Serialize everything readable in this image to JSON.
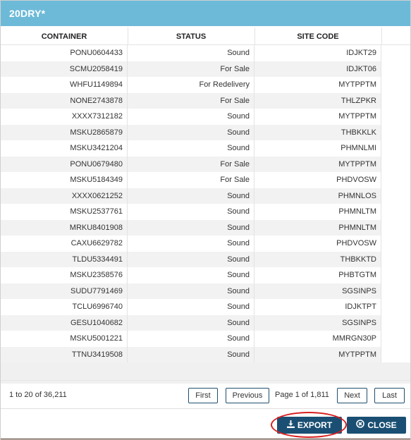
{
  "window": {
    "title": "20DRY*"
  },
  "table": {
    "columns": [
      "CONTAINER",
      "STATUS",
      "SITE CODE"
    ],
    "rows": [
      [
        "PONU0604433",
        "Sound",
        "IDJKT29"
      ],
      [
        "SCMU2058419",
        "For Sale",
        "IDJKT06"
      ],
      [
        "WHFU1149894",
        "For Redelivery",
        "MYTPPTM"
      ],
      [
        "NONE2743878",
        "For Sale",
        "THLZPKR"
      ],
      [
        "XXXX7312182",
        "Sound",
        "MYTPPTM"
      ],
      [
        "MSKU2865879",
        "Sound",
        "THBKKLK"
      ],
      [
        "MSKU3421204",
        "Sound",
        "PHMNLMI"
      ],
      [
        "PONU0679480",
        "For Sale",
        "MYTPPTM"
      ],
      [
        "MSKU5184349",
        "For Sale",
        "PHDVOSW"
      ],
      [
        "XXXX0621252",
        "Sound",
        "PHMNLOS"
      ],
      [
        "MSKU2537761",
        "Sound",
        "PHMNLTM"
      ],
      [
        "MRKU8401908",
        "Sound",
        "PHMNLTM"
      ],
      [
        "CAXU6629782",
        "Sound",
        "PHDVOSW"
      ],
      [
        "TLDU5334491",
        "Sound",
        "THBKKTD"
      ],
      [
        "MSKU2358576",
        "Sound",
        "PHBTGTM"
      ],
      [
        "SUDU7791469",
        "Sound",
        "SGSINPS"
      ],
      [
        "TCLU6996740",
        "Sound",
        "IDJKTPT"
      ],
      [
        "GESU1040682",
        "Sound",
        "SGSINPS"
      ],
      [
        "MSKU5001221",
        "Sound",
        "MMRGN30P"
      ],
      [
        "TTNU3419508",
        "Sound",
        "MYTPPTM"
      ]
    ]
  },
  "pager": {
    "range_text": "1 to 20 of 36,211",
    "first_label": "First",
    "previous_label": "Previous",
    "page_text": "Page 1 of 1,811",
    "next_label": "Next",
    "last_label": "Last"
  },
  "footer": {
    "export_label": "EXPORT",
    "export_icon": "download-icon",
    "close_label": "CLOSE",
    "close_icon": "close-circle-icon"
  },
  "colors": {
    "title_bar": "#6dbad8",
    "button_bg": "#1a4f73",
    "highlight": "#d81f1f"
  }
}
